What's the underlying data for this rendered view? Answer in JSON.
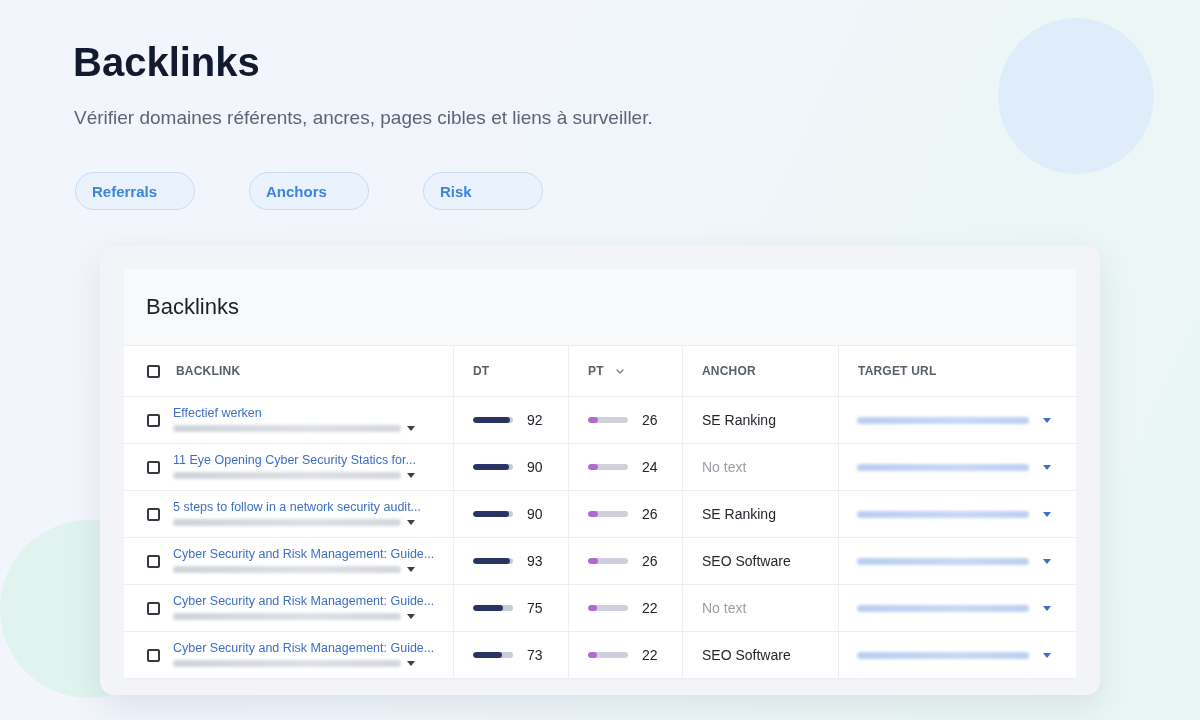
{
  "page": {
    "title": "Backlinks",
    "subtitle": "Vérifier domaines référents, ancres, pages cibles et liens à surveiller."
  },
  "tabs": [
    {
      "label": "Referrals",
      "selected": false
    },
    {
      "label": "Anchors",
      "selected": false
    },
    {
      "label": "Risk",
      "selected": false
    }
  ],
  "panel": {
    "title": "Backlinks",
    "select_all": {
      "checked": false
    },
    "columns": [
      {
        "label": "BACKLINK",
        "sortable": false
      },
      {
        "label": "DT",
        "sortable": false
      },
      {
        "label": "PT",
        "sortable": true
      },
      {
        "label": "ANCHOR",
        "sortable": false
      },
      {
        "label": "TARGET URL",
        "sortable": false
      }
    ],
    "rows": [
      {
        "checked": false,
        "title": "Effectief werken",
        "dt": {
          "value": "92",
          "level": 0.92
        },
        "pt": {
          "value": "26",
          "level": 0.26
        },
        "anchor": "SE Ranking",
        "anchor_missing": false
      },
      {
        "checked": false,
        "title": "11 Eye Opening Cyber Security Statics for...",
        "dt": {
          "value": "90",
          "level": 0.9
        },
        "pt": {
          "value": "24",
          "level": 0.24
        },
        "anchor": "No text",
        "anchor_missing": true
      },
      {
        "checked": false,
        "title": "5 steps to follow in a network security audit...",
        "dt": {
          "value": "90",
          "level": 0.9
        },
        "pt": {
          "value": "26",
          "level": 0.26
        },
        "anchor": "SE Ranking",
        "anchor_missing": false
      },
      {
        "checked": false,
        "title": "Cyber Security and Risk Management: Guide...",
        "dt": {
          "value": "93",
          "level": 0.93
        },
        "pt": {
          "value": "26",
          "level": 0.26
        },
        "anchor": "SEO Software",
        "anchor_missing": false
      },
      {
        "checked": false,
        "title": "Cyber Security and Risk Management: Guide...",
        "dt": {
          "value": "75",
          "level": 0.75
        },
        "pt": {
          "value": "22",
          "level": 0.22
        },
        "anchor": "No text",
        "anchor_missing": true
      },
      {
        "checked": false,
        "title": "Cyber Security and Risk Management: Guide...",
        "dt": {
          "value": "73",
          "level": 0.73
        },
        "pt": {
          "value": "22",
          "level": 0.22
        },
        "anchor": "SEO Software",
        "anchor_missing": false
      }
    ]
  }
}
